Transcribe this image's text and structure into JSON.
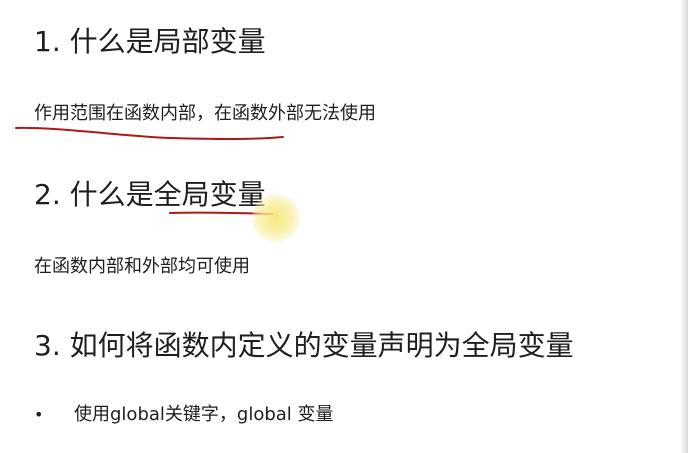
{
  "slide": {
    "heading1": "1. 什么是局部变量",
    "text1": "作用范围在函数内部，在函数外部无法使用",
    "heading2_prefix": "2. 什么是",
    "heading2_highlight": "全局变量",
    "text2": "在函数内部和外部均可使用",
    "heading3": "3. 如何将函数内定义的变量声明为全局变量",
    "bullet_symbol": "•",
    "bullet1": "使用global关键字，global 变量"
  },
  "colors": {
    "text": "#1e1e1e",
    "pen_annotation": "#b01818",
    "cursor_highlight": "#f4e778",
    "background": "#ffffff"
  },
  "icons": {
    "cursor": "cursor-highlight-icon"
  }
}
